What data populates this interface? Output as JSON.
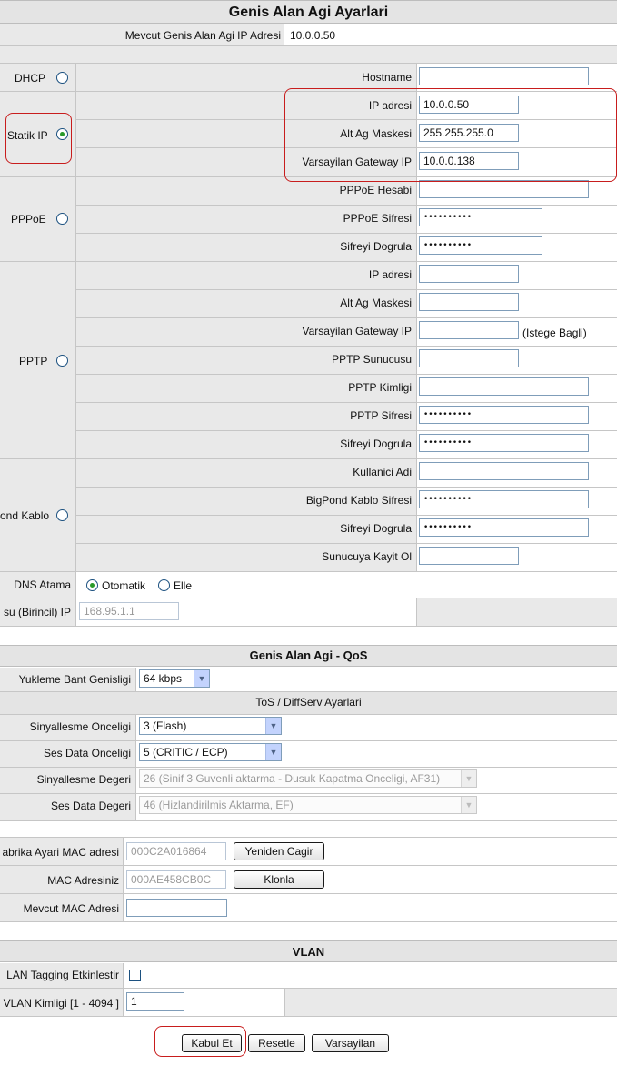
{
  "wan": {
    "title": "Genis Alan Agi Ayarlari",
    "current_ip_label": "Mevcut Genis Alan Agi IP Adresi",
    "current_ip_value": "10.0.0.50",
    "dhcp": {
      "label": "DHCP",
      "hostname_label": "Hostname",
      "hostname_value": ""
    },
    "static": {
      "label": "Statik IP",
      "ip_label": "IP adresi",
      "ip_value": "10.0.0.50",
      "mask_label": "Alt Ag Maskesi",
      "mask_value": "255.255.255.0",
      "gateway_label": "Varsayilan Gateway IP",
      "gateway_value": "10.0.0.138"
    },
    "pppoe": {
      "label": "PPPoE",
      "account_label": "PPPoE Hesabi",
      "account_value": "",
      "password_label": "PPPoE Sifresi",
      "password_value": "••••••••••",
      "confirm_label": "Sifreyi Dogrula",
      "confirm_value": "••••••••••"
    },
    "pptp": {
      "label": "PPTP",
      "ip_label": "IP adresi",
      "ip_value": "",
      "mask_label": "Alt Ag Maskesi",
      "mask_value": "",
      "gateway_label": "Varsayilan Gateway IP",
      "gateway_value": "",
      "gateway_note": "(Istege Bagli)",
      "server_label": "PPTP Sunucusu",
      "server_value": "",
      "id_label": "PPTP Kimligi",
      "id_value": "",
      "password_label": "PPTP Sifresi",
      "password_value": "••••••••••",
      "confirm_label": "Sifreyi Dogrula",
      "confirm_value": "••••••••••"
    },
    "bigpond": {
      "label": "ond Kablo",
      "user_label": "Kullanici Adi",
      "user_value": "",
      "password_label": "BigPond Kablo Sifresi",
      "password_value": "••••••••••",
      "confirm_label": "Sifreyi Dogrula",
      "confirm_value": "••••••••••",
      "server_label": "Sunucuya Kayit Ol",
      "server_value": ""
    },
    "dns": {
      "label": "DNS Atama",
      "auto_label": "Otomatik",
      "manual_label": "Elle",
      "primary_label": "su (Birincil) IP",
      "primary_value": "168.95.1.1"
    }
  },
  "qos": {
    "title": "Genis Alan Agi - QoS",
    "upload_label": "Yukleme Bant Genisligi",
    "upload_value": "64 kbps",
    "tos_title": "ToS / DiffServ Ayarlari",
    "sig_priority_label": "Sinyallesme Onceligi",
    "sig_priority_value": "3 (Flash)",
    "voice_priority_label": "Ses Data Onceligi",
    "voice_priority_value": "5 (CRITIC / ECP)",
    "sig_value_label": "Sinyallesme Degeri",
    "sig_value_value": "26 (Sinif 3 Guvenli aktarma - Dusuk Kapatma Onceligi, AF31)",
    "voice_value_label": "Ses Data Degeri",
    "voice_value_value": "46 (Hizlandirilmis Aktarma, EF)"
  },
  "mac": {
    "factory_label": "abrika Ayari MAC adresi",
    "factory_value": "000C2A016864",
    "restore_button": "Yeniden Cagir",
    "your_label": "MAC Adresiniz",
    "your_value": "000AE458CB0C",
    "clone_button": "Klonla",
    "current_label": "Mevcut MAC Adresi",
    "current_value": ""
  },
  "vlan": {
    "title": "VLAN",
    "tagging_label": "LAN Tagging Etkinlestir",
    "id_label": "VLAN Kimligi [1 - 4094 ]",
    "id_value": "1"
  },
  "actions": {
    "apply": "Kabul Et",
    "reset": "Resetle",
    "default": "Varsayilan"
  }
}
